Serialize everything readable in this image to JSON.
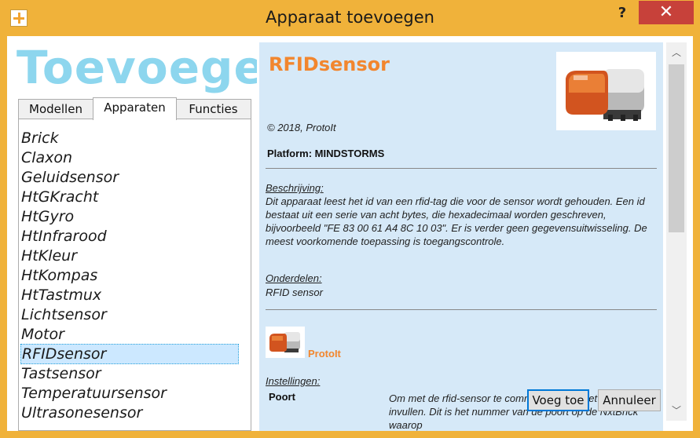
{
  "window": {
    "title": "Apparaat toevoegen",
    "help_glyph": "?",
    "close_glyph": "✕"
  },
  "banner": {
    "text": "Toevoegen"
  },
  "tabs": [
    {
      "label": "Modellen",
      "active": false
    },
    {
      "label": "Apparaten",
      "active": true
    },
    {
      "label": "Functies",
      "active": false
    }
  ],
  "devices": [
    "Brick",
    "Claxon",
    "Geluidsensor",
    "HtGKracht",
    "HtGyro",
    "HtInfrarood",
    "HtKleur",
    "HtKompas",
    "HtTastmux",
    "Lichtsensor",
    "Motor",
    "RFIDsensor",
    "Tastsensor",
    "Temperatuursensor",
    "Ultrasonesensor"
  ],
  "selected_device": "RFIDsensor",
  "detail": {
    "title": "RFIDsensor",
    "copyright": "© 2018, ProtoIt",
    "platform": "Platform: MINDSTORMS",
    "description_label": "Beschrijving:",
    "description": "Dit apparaat leest het id van een rfid-tag die voor de sensor wordt gehouden. Een id bestaat uit een serie van acht bytes, die hexadecimaal worden geschreven, bijvoorbeeld \"FE 83 00 61 A4 8C 10 03\". Er is verder geen gegevensuitwisseling. De meest voorkomende toepassing is toegangscontrole.",
    "parts_label": "Onderdelen:",
    "parts": "RFID sensor",
    "author": "ProtoIt",
    "settings_label": "Instellingen:",
    "setting_name": "Poort",
    "setting_description": "Om met de rfid-sensor te communiceren moet je de Poort invullen. Dit is het nummer van de poort op de NxtBrick waarop"
  },
  "buttons": {
    "add": "Voeg toe",
    "cancel": "Annuleer"
  },
  "colors": {
    "accent": "#f2862e",
    "titlebar": "#f0b23a",
    "detail_bg": "#d6e9f8",
    "banner": "#8dd6ee",
    "selection": "#cce8ff"
  }
}
